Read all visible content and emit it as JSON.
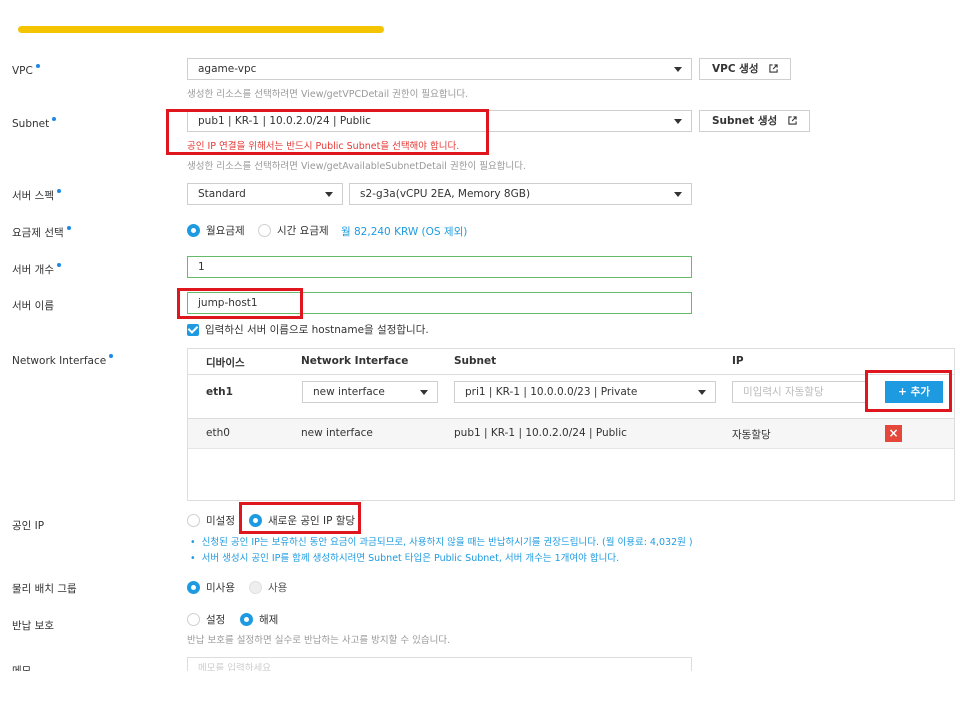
{
  "labels": {
    "vpc": "VPC",
    "subnet": "Subnet",
    "server_spec": "서버 스펙",
    "billing": "요금제 선택",
    "server_count": "서버 개수",
    "server_name": "서버 이름",
    "network_interface": "Network Interface",
    "public_ip": "공인 IP",
    "placement_group": "물리 배치 그룹",
    "return_protection": "반납 보호",
    "memo": "메모"
  },
  "vpc": {
    "value": "agame-vpc",
    "create_button": "VPC 생성",
    "hint": "생성한 리소스를 선택하려면 View/getVPCDetail 권한이 필요합니다."
  },
  "subnet": {
    "value": "pub1 | KR-1 | 10.0.2.0/24 | Public",
    "create_button": "Subnet 생성",
    "error": "공인 IP 연결을 위해서는 반드시 Public Subnet을 선택해야 합니다.",
    "hint": "생성한 리소스를 선택하려면 View/getAvailableSubnetDetail 권한이 필요합니다."
  },
  "server_spec": {
    "type": "Standard",
    "spec": "s2-g3a(vCPU 2EA, Memory 8GB)"
  },
  "billing": {
    "monthly": "월요금제",
    "hourly": "시간 요금제",
    "price": "월 82,240 KRW (OS 제외)"
  },
  "server_count": {
    "value": "1"
  },
  "server_name": {
    "value": "jump-host1",
    "hostname_checkbox": "입력하신 서버 이름으로 hostname을 설정합니다."
  },
  "network_table": {
    "headers": [
      "디바이스",
      "Network Interface",
      "Subnet",
      "IP"
    ],
    "input_row": {
      "device": "eth1",
      "interface": "new interface",
      "subnet": "pri1 | KR-1 | 10.0.0.0/23 | Private",
      "ip_placeholder": "미입력시 자동할당",
      "add_button": "+ 추가"
    },
    "rows": [
      {
        "device": "eth0",
        "interface": "new interface",
        "subnet": "pub1 | KR-1 | 10.0.2.0/24 | Public",
        "ip": "자동할당",
        "delete": "×"
      }
    ]
  },
  "public_ip": {
    "none": "미설정",
    "new": "새로운 공인 IP 할당",
    "note1": "신청된 공인 IP는 보유하신 동안 요금이 과금되므로, 사용하지 않을 때는 반납하시기를 권장드립니다. (월 이용료: 4,032원 )",
    "note2": "서버 생성시 공인 IP를 함께 생성하시려면 Subnet 타입은 Public Subnet, 서버 개수는 1개여야 합니다."
  },
  "placement_group": {
    "unused": "미사용",
    "used": "사용"
  },
  "return_protection": {
    "set": "설정",
    "unset": "해제",
    "hint": "반납 보호를 설정하면 실수로 반납하는 사고를 방지할 수 있습니다."
  },
  "memo": {
    "placeholder": "메모를 입력하세요"
  },
  "colors": {
    "accent": "#1e9be0",
    "highlight": "#e0161f",
    "danger": "#e5473b",
    "progress": "#f5c400"
  }
}
